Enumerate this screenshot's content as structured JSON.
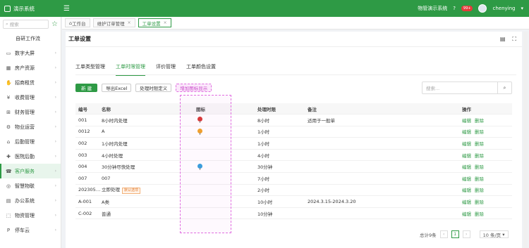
{
  "app": {
    "title": "演示系统",
    "org": "物管演示系统",
    "badge": "99+",
    "user": "chenying"
  },
  "sidebar": {
    "search_placeholder": "搜索",
    "items": [
      {
        "label": "自研工作流",
        "icon": "",
        "plain": true
      },
      {
        "label": "数字大屏",
        "icon": "screen-icon"
      },
      {
        "label": "房产资源",
        "icon": "building-icon"
      },
      {
        "label": "招商租赁",
        "icon": "handshake-icon"
      },
      {
        "label": "收费管理",
        "icon": "money-icon"
      },
      {
        "label": "财务管理",
        "icon": "finance-icon"
      },
      {
        "label": "物业运营",
        "icon": "operation-icon"
      },
      {
        "label": "后勤管理",
        "icon": "logistics-icon"
      },
      {
        "label": "医院后勤",
        "icon": "hospital-icon"
      },
      {
        "label": "客户服务",
        "icon": "customer-service-icon",
        "active": true
      },
      {
        "label": "智慧物联",
        "icon": "iot-icon"
      },
      {
        "label": "办公系统",
        "icon": "office-icon"
      },
      {
        "label": "物资管理",
        "icon": "materials-icon"
      },
      {
        "label": "停车云",
        "icon": "parking-icon"
      }
    ]
  },
  "tabs": [
    {
      "label": "工作台",
      "icon": "home-icon"
    },
    {
      "label": "维护订单管理",
      "closable": true
    },
    {
      "label": "工单设置",
      "closable": true,
      "active": true
    }
  ],
  "page": {
    "title": "工单设置",
    "subtabs": [
      "工单类型管理",
      "工单时限管理",
      "评价管理",
      "工单颜色设置"
    ],
    "active_subtab": 1,
    "buttons": {
      "new": "新 建",
      "export": "导出Excel",
      "define": "处理时限定义",
      "add_icon": "增加图标显示"
    },
    "search_placeholder": "搜索..."
  },
  "table": {
    "headers": [
      "编号",
      "名称",
      "图标",
      "处理时限",
      "备注",
      "操作"
    ],
    "edit": "编辑",
    "delete": "删除",
    "rows": [
      {
        "code": "001",
        "name": "8小时内处理",
        "icon_color": "#d7312e",
        "limit": "8小时",
        "note": "适用于一般单",
        "tag": ""
      },
      {
        "code": "0012",
        "name": "A",
        "icon_color": "#f0a020",
        "limit": "1小时",
        "note": "",
        "tag": ""
      },
      {
        "code": "002",
        "name": "1小时内处理",
        "icon_color": "",
        "limit": "1小时",
        "note": "",
        "tag": ""
      },
      {
        "code": "003",
        "name": "4小时处理",
        "icon_color": "",
        "limit": "4小时",
        "note": "",
        "tag": ""
      },
      {
        "code": "004",
        "name": "30分钟尽快处理",
        "icon_color": "#2d9cdb",
        "limit": "30分钟",
        "note": "",
        "tag": ""
      },
      {
        "code": "007",
        "name": "007",
        "icon_color": "",
        "limit": "7小时",
        "note": "",
        "tag": ""
      },
      {
        "code": "202305…",
        "name": "立即处理",
        "icon_color": "",
        "limit": "2小时",
        "note": "",
        "tag": "默认选项"
      },
      {
        "code": "A-001",
        "name": "A类",
        "icon_color": "",
        "limit": "10小时",
        "note": "2024.3.15-2024.3.20",
        "tag": ""
      },
      {
        "code": "C-002",
        "name": "普通",
        "icon_color": "",
        "limit": "10分钟",
        "note": "",
        "tag": ""
      }
    ]
  },
  "pager": {
    "total": "总计9条",
    "prev": "‹",
    "current": "1",
    "next": "›",
    "size": "10 条/页"
  },
  "colors": {
    "primary": "#2e9a45",
    "highlight": "#e06de0"
  }
}
